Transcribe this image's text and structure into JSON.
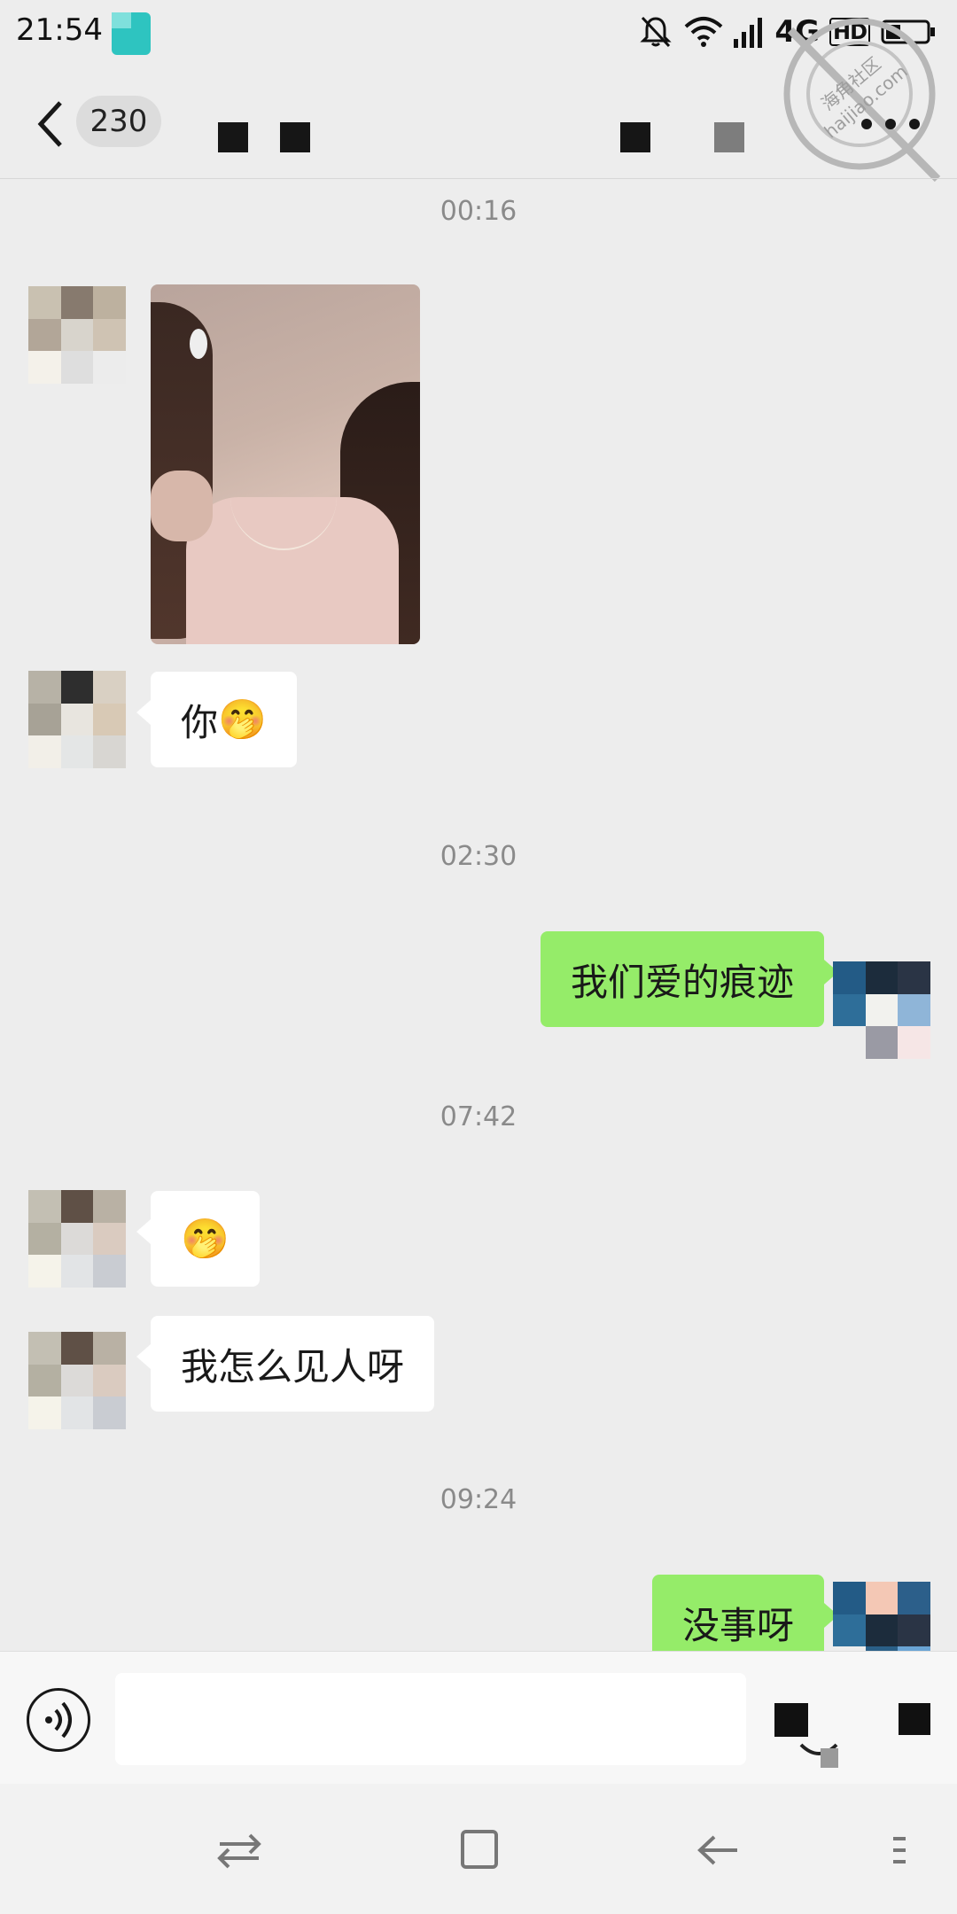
{
  "status_bar": {
    "time": "21:54",
    "network": "4G",
    "hd": "HD"
  },
  "watermark": {
    "line1": "海角社区",
    "line2": "haijiao.com"
  },
  "nav": {
    "unread_count": "230"
  },
  "chat": {
    "timestamps": [
      "00:16",
      "02:30",
      "07:42",
      "09:24"
    ],
    "messages": [
      {
        "side": "left",
        "type": "image"
      },
      {
        "side": "left",
        "text": "你",
        "emoji": "🤭"
      },
      {
        "side": "right",
        "text": "我们爱的痕迹"
      },
      {
        "side": "left",
        "emoji": "🤭"
      },
      {
        "side": "left",
        "text": "我怎么见人呀"
      },
      {
        "side": "right",
        "text": "没事呀"
      }
    ]
  },
  "colors": {
    "background": "#ededed",
    "sent_bubble": "#95ec69",
    "received_bubble": "#ffffff",
    "timestamp": "#8a8a8a"
  },
  "icons": [
    "silent-bell-icon",
    "wifi-icon",
    "signal-icon",
    "battery-icon",
    "back-icon",
    "more-icon",
    "voice-icon",
    "emoji-icon",
    "plus-icon",
    "recents-icon",
    "home-icon",
    "back-nav-icon",
    "menu-icon"
  ]
}
